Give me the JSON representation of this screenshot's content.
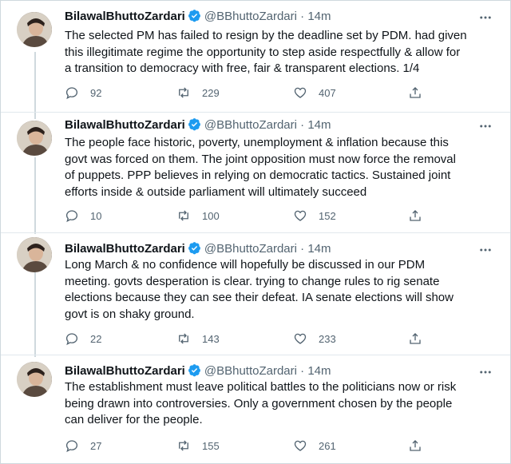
{
  "colors": {
    "text": "#0f1419",
    "secondary": "#536471",
    "verified": "#1d9bf0",
    "thread_line": "#cfd9de",
    "separator": "#e1e8ed"
  },
  "icons": {
    "reply": "reply-icon",
    "retweet": "retweet-icon",
    "like": "like-icon",
    "share": "share-icon",
    "more": "more-icon",
    "verified": "verified-badge-icon"
  },
  "tweets": [
    {
      "name": "BilawalBhuttoZardari",
      "handle": "@BBhuttoZardari",
      "dot": "·",
      "time": "14m",
      "text": "The selected PM has failed to resign by the deadline set by PDM. had given\nthis illegitimate regime the opportunity to step aside respectfully & allow for\na transition to democracy with free, fair & transparent elections. 1/4",
      "replies": "92",
      "retweets": "229",
      "likes": "407"
    },
    {
      "name": "BilawalBhuttoZardari",
      "handle": "@BBhuttoZardari",
      "dot": "·",
      "time": "14m",
      "text": "The people face historic, poverty, unemployment & inflation because this\ngovt was forced on them. The joint opposition must now force the removal\nof puppets. PPP believes in relying on democratic tactics. Sustained joint\nefforts inside & outside parliament will ultimately succeed",
      "replies": "10",
      "retweets": "100",
      "likes": "152"
    },
    {
      "name": "BilawalBhuttoZardari",
      "handle": "@BBhuttoZardari",
      "dot": "·",
      "time": "14m",
      "text": "Long March & no confidence will hopefully be discussed in our PDM\nmeeting. govts desperation is clear. trying to change rules to rig senate\nelections because they can see their defeat. IA senate elections will show\ngovt is on shaky ground.",
      "replies": "22",
      "retweets": "143",
      "likes": "233"
    },
    {
      "name": "BilawalBhuttoZardari",
      "handle": "@BBhuttoZardari",
      "dot": "·",
      "time": "14m",
      "text": "The establishment must leave political battles to the politicians now or risk\nbeing drawn into controversies. Only a government chosen by the people\ncan deliver for the people.",
      "replies": "27",
      "retweets": "155",
      "likes": "261"
    }
  ]
}
